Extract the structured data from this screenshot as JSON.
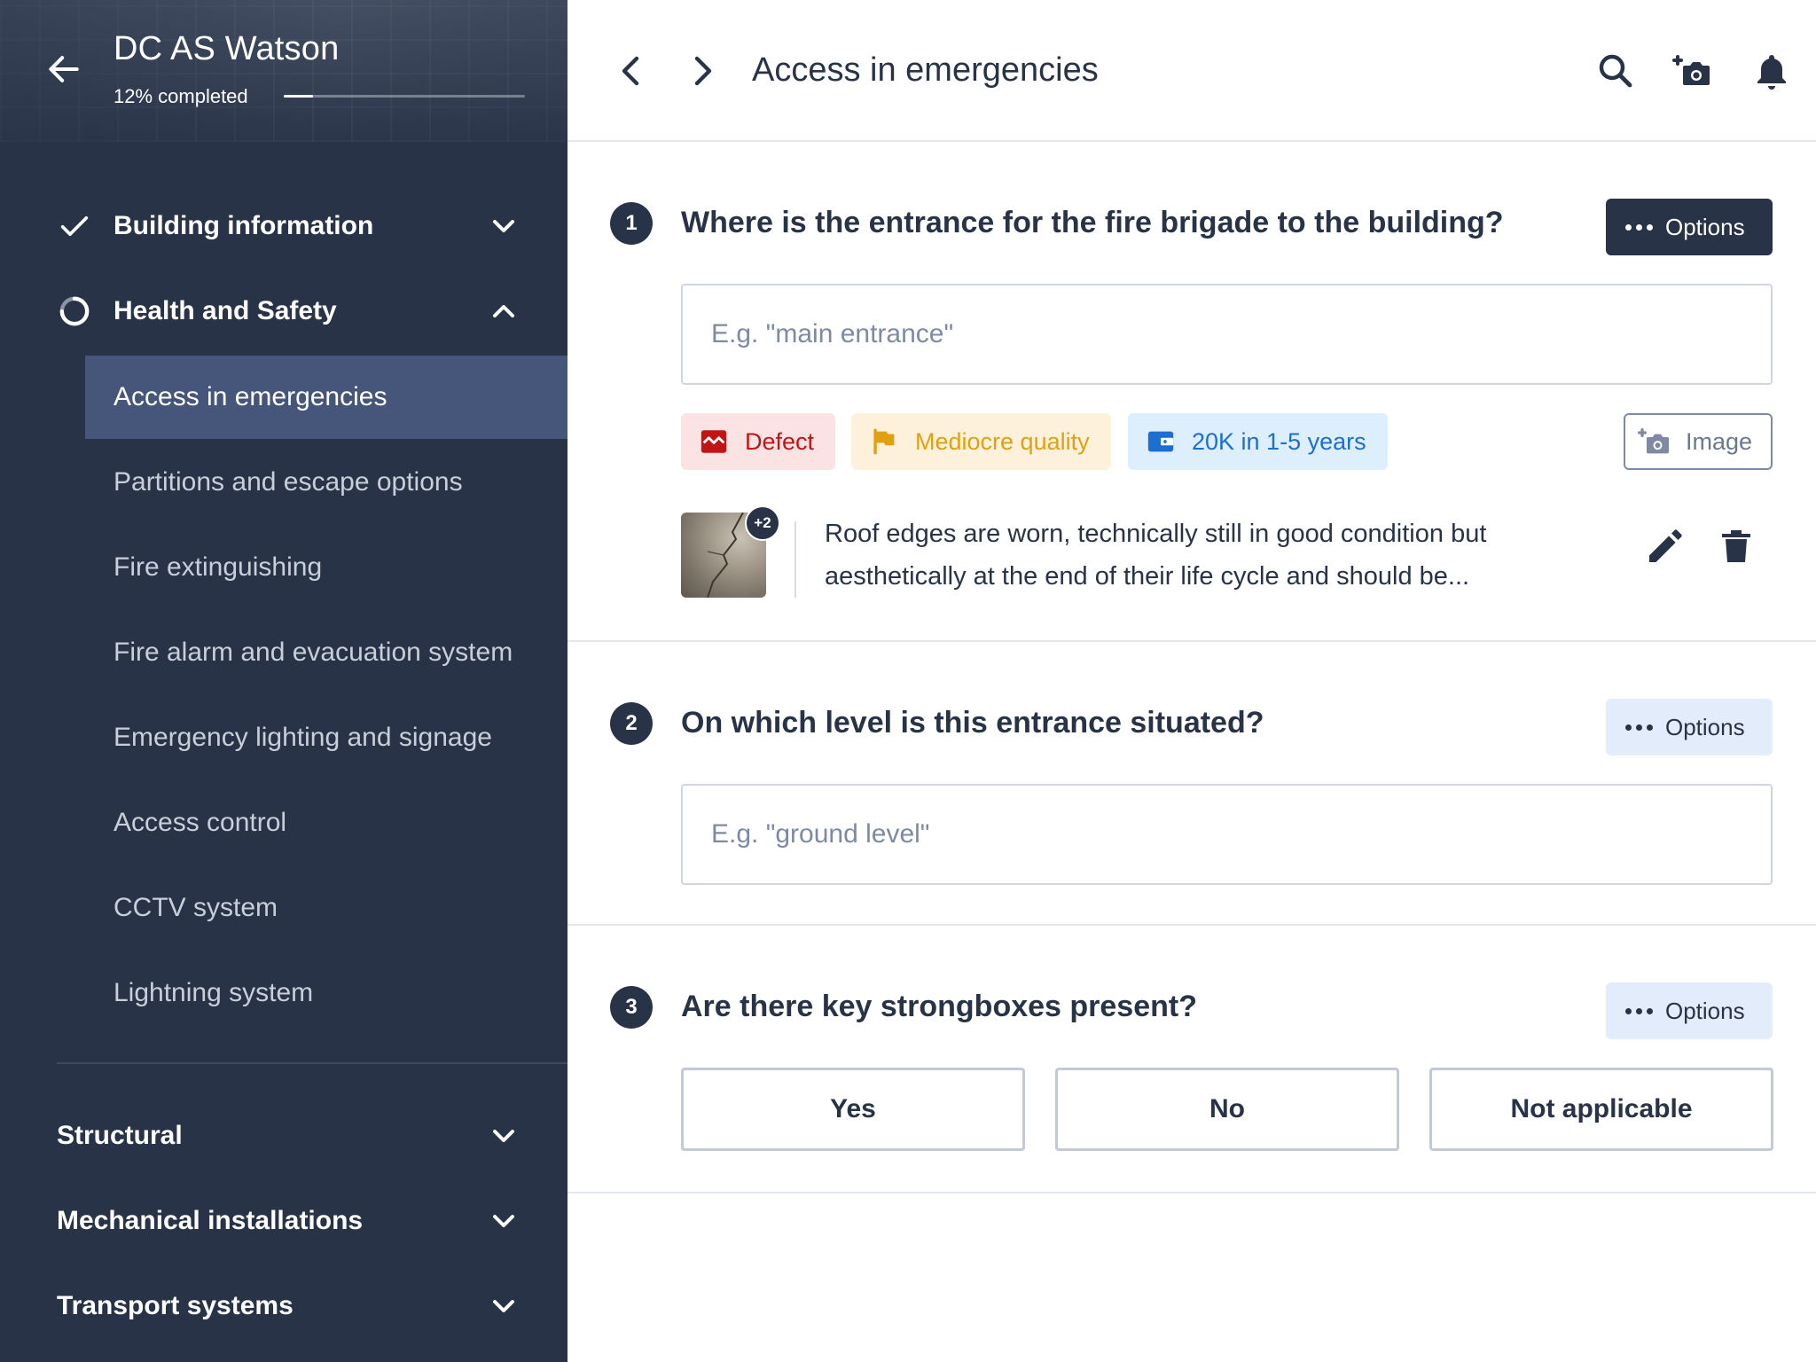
{
  "sidebar": {
    "project_title": "DC AS Watson",
    "progress_label": "12% completed",
    "progress_fraction": 0.12,
    "sections_top": [
      {
        "label": "Building information",
        "status": "complete",
        "expanded": false
      },
      {
        "label": "Health and Safety",
        "status": "in-progress",
        "expanded": true
      }
    ],
    "subitems": [
      {
        "label": "Access in emergencies",
        "active": true
      },
      {
        "label": "Partitions and escape options"
      },
      {
        "label": "Fire extinguishing"
      },
      {
        "label": "Fire alarm and evacuation system"
      },
      {
        "label": "Emergency lighting and signage"
      },
      {
        "label": "Access control"
      },
      {
        "label": "CCTV system"
      },
      {
        "label": "Lightning system"
      }
    ],
    "sections_bottom": [
      {
        "label": "Structural"
      },
      {
        "label": "Mechanical installations"
      },
      {
        "label": "Transport systems"
      }
    ]
  },
  "topbar": {
    "title": "Access in emergencies",
    "icons": [
      "chevron-left-icon",
      "chevron-right-icon",
      "search-icon",
      "add-photo-icon",
      "bell-icon"
    ]
  },
  "questions": [
    {
      "number": "1",
      "text": "Where is the entrance for the fire brigade to the building?",
      "options_label": "Options",
      "input_placeholder": "E.g. \"main entrance\"",
      "input_value": "",
      "tags": [
        {
          "label": "Defect",
          "icon": "defect-icon",
          "color": "#c21414"
        },
        {
          "label": "Mediocre quality",
          "icon": "flag-icon",
          "color": "#e0a010"
        },
        {
          "label": "20K in 1-5 years",
          "icon": "wallet-icon",
          "color": "#1c6fd0"
        }
      ],
      "image_button_label": "Image",
      "note": {
        "photo_count_badge": "+2",
        "text": "Roof edges are worn, technically still in good condition but aesthetically at the end of their life cycle and should be..."
      }
    },
    {
      "number": "2",
      "text": "On which level is this entrance situated?",
      "options_label": "Options",
      "input_placeholder": "E.g. \"ground level\"",
      "input_value": ""
    },
    {
      "number": "3",
      "text": "Are there key strongboxes present?",
      "options_label": "Options",
      "choices": [
        "Yes",
        "No",
        "Not applicable"
      ]
    }
  ],
  "colors": {
    "sidebar_bg": "#283348",
    "active_item_bg": "#46557a",
    "primary_dark": "#283348",
    "options_light_bg": "#e3ecfb"
  }
}
